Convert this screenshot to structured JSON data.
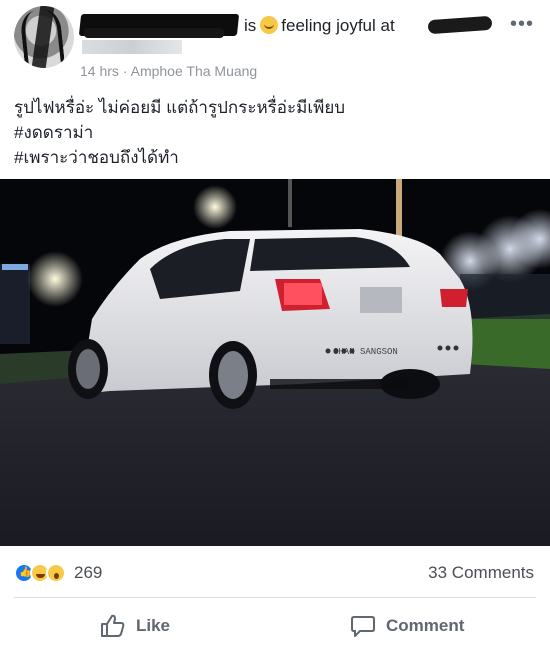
{
  "post": {
    "header": {
      "status_prefix": "is",
      "feeling_text": "feeling joyful at",
      "more_symbol": "•••"
    },
    "meta": {
      "time": "14 hrs",
      "separator": "·",
      "location": "Amphoe Tha Muang"
    },
    "body_lines": [
      "รูปไฟหรื่อ่ะ ไม่ค่อยมี แต่ถ้ารูปกระหรื่อ่ะมีเพียบ",
      "#งดดราม่า",
      "#เพราะว่าชอบถึงได้ทำ"
    ],
    "photo": {
      "plate_text": "CHAN SANGSON",
      "icon": "car-photo"
    },
    "stats": {
      "reaction_count": "269",
      "comments_count": "33 Comments",
      "reaction_icons": [
        "like-icon",
        "haha-icon",
        "wow-icon"
      ]
    },
    "actions": {
      "like_label": "Like",
      "comment_label": "Comment"
    }
  },
  "colors": {
    "text": "#1d2129",
    "muted": "#90949c",
    "action": "#606770",
    "like_blue": "#1877f2"
  }
}
